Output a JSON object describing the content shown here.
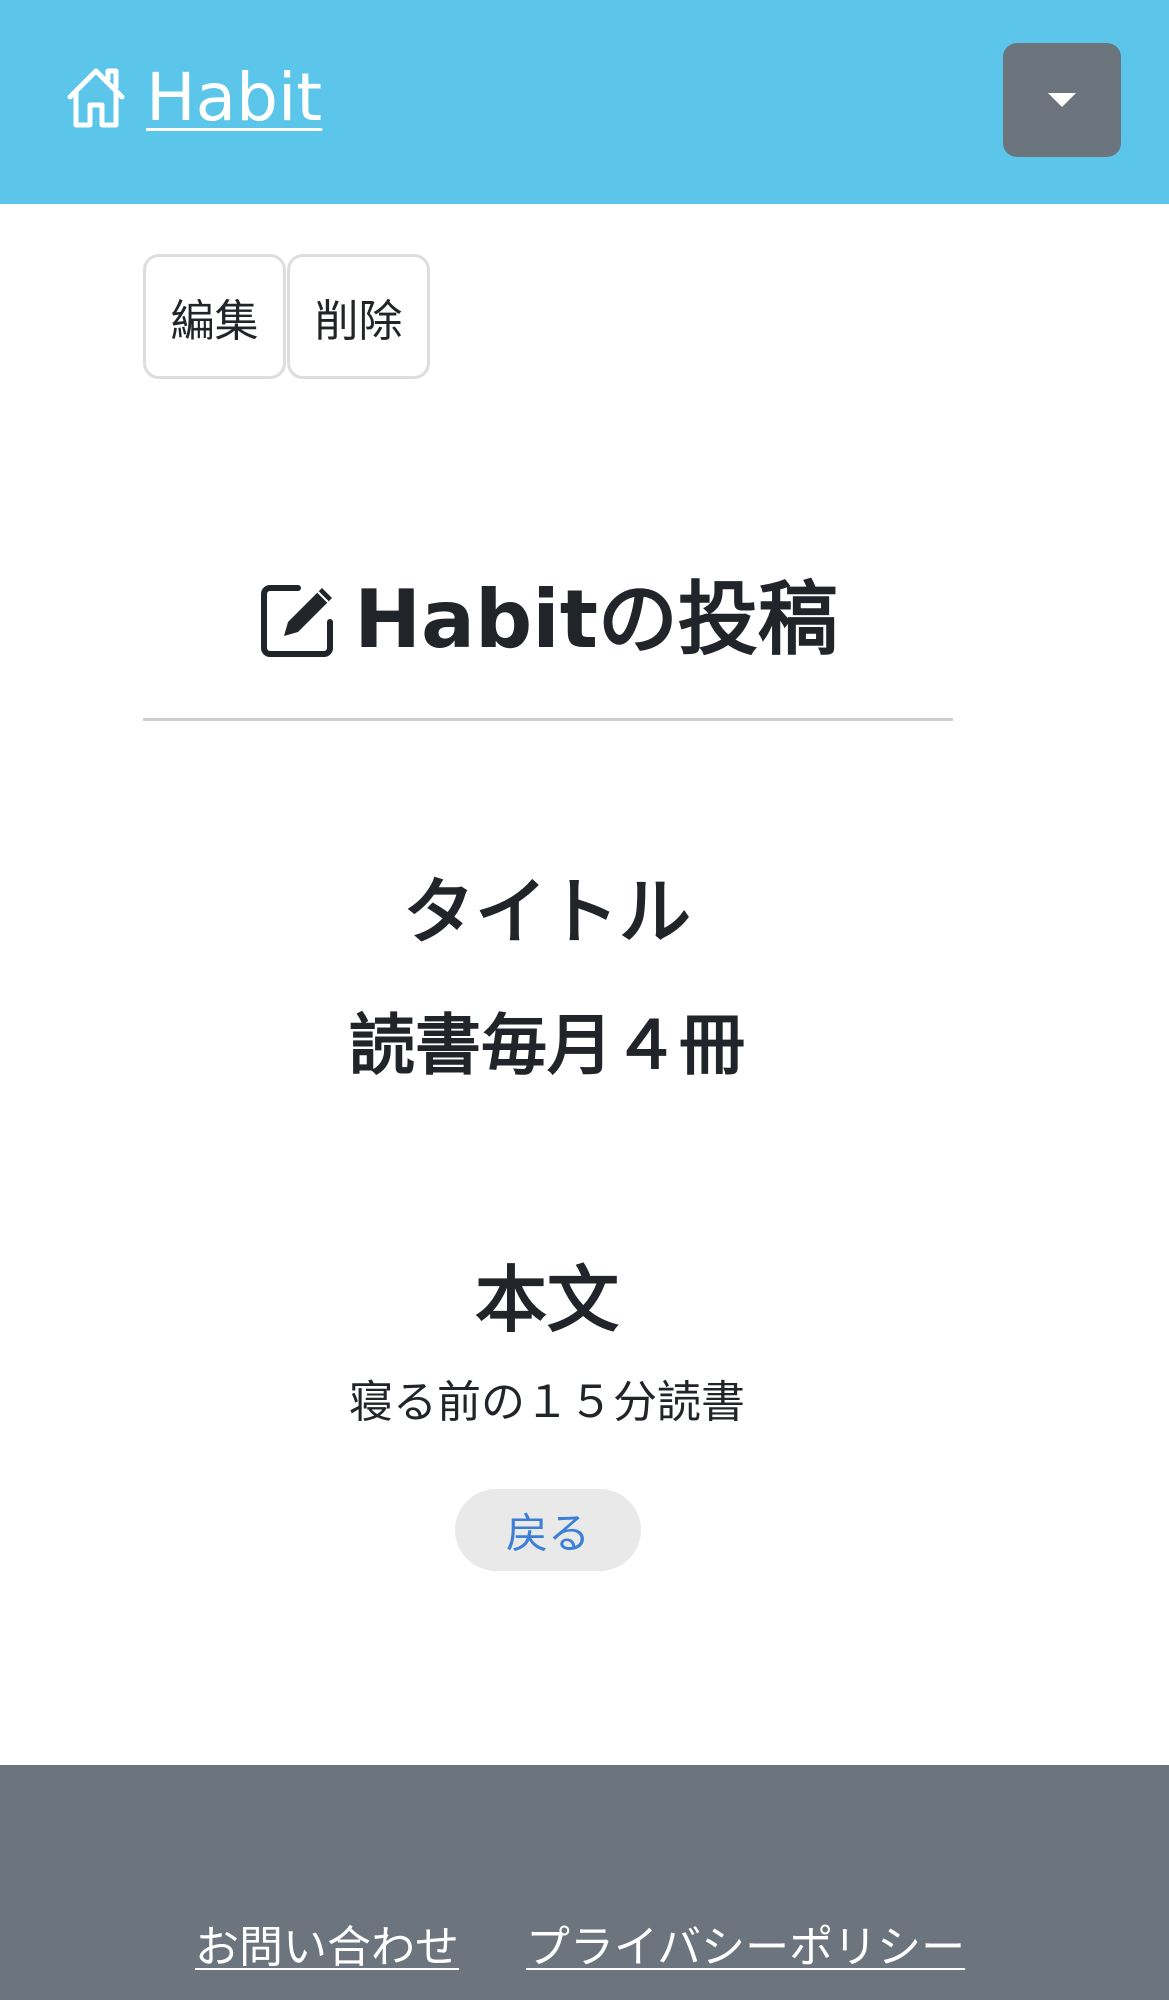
{
  "header": {
    "brand_label": "Habit",
    "brand_icon": "house-icon",
    "dropdown_icon": "caret-down-icon",
    "background_color": "#5bc6ea"
  },
  "actions": {
    "edit_label": "編集",
    "delete_label": "削除"
  },
  "post": {
    "heading_icon": "pencil-square-icon",
    "heading": "Habitの投稿",
    "title_label": "タイトル",
    "title_value": "読書毎月４冊",
    "body_label": "本文",
    "body_value": "寝る前の１５分読書",
    "back_label": "戻る"
  },
  "footer": {
    "contact_label": "お問い合わせ",
    "privacy_label": "プライバシーポリシー",
    "background_color": "#6c757d"
  }
}
